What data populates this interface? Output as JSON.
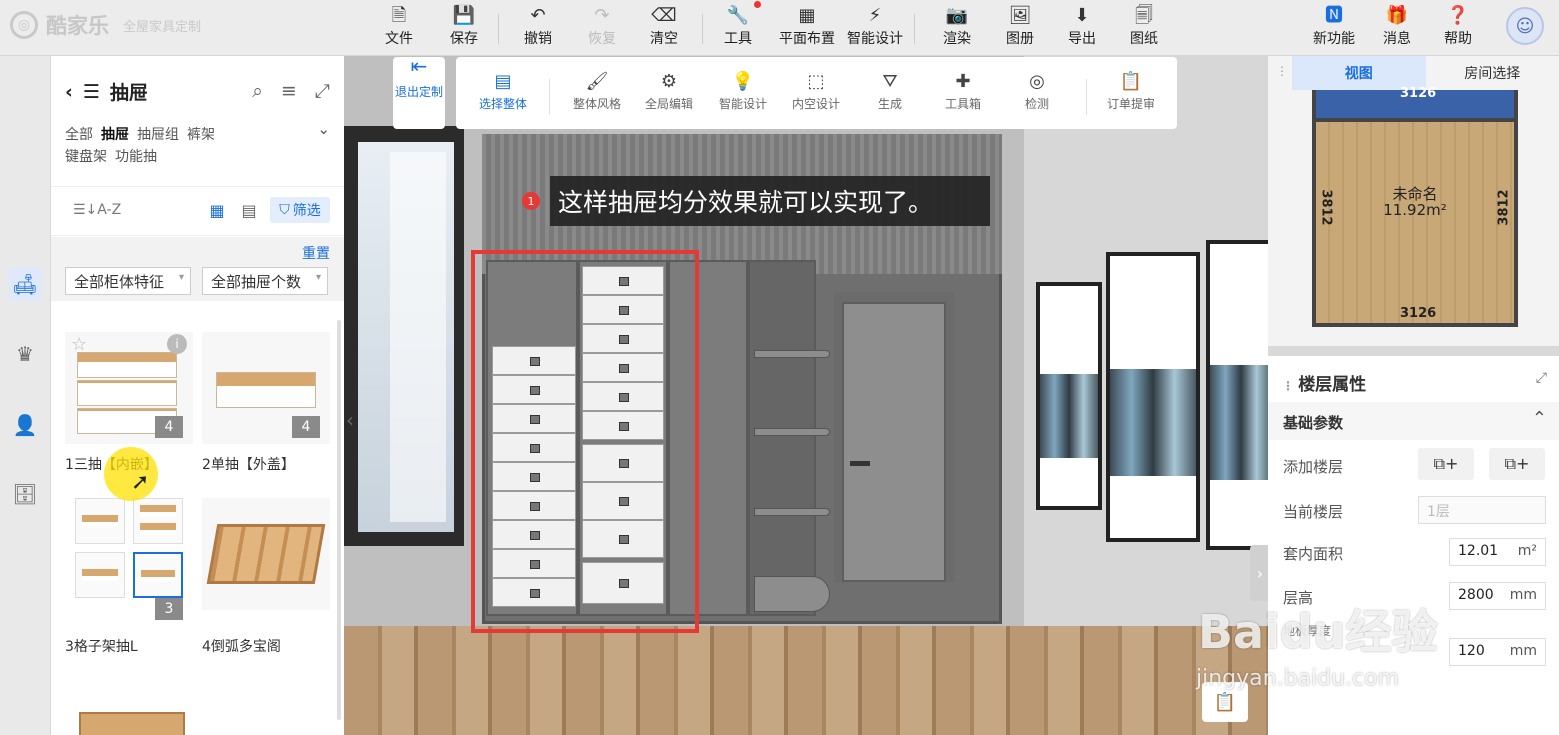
{
  "app": {
    "brand": "酷家乐",
    "sub": "全屋家具定制"
  },
  "toolbar": {
    "items": [
      {
        "label": "文件",
        "icon": "file-icon"
      },
      {
        "label": "保存",
        "icon": "save-icon"
      },
      {
        "label": "撤销",
        "icon": "undo-icon"
      },
      {
        "label": "恢复",
        "icon": "redo-icon"
      },
      {
        "label": "清空",
        "icon": "eraser-icon"
      },
      {
        "label": "工具",
        "icon": "wrench-icon"
      },
      {
        "label": "平面布置",
        "icon": "floorplan-icon"
      },
      {
        "label": "智能设计",
        "icon": "lightning-icon"
      },
      {
        "label": "渲染",
        "icon": "camera-icon"
      },
      {
        "label": "图册",
        "icon": "album-icon"
      },
      {
        "label": "导出",
        "icon": "export-icon"
      },
      {
        "label": "图纸",
        "icon": "drawing-icon"
      }
    ],
    "right": [
      {
        "label": "新功能",
        "icon": "new-feature-icon"
      },
      {
        "label": "消息",
        "icon": "gift-icon"
      },
      {
        "label": "帮助",
        "icon": "help-icon"
      }
    ]
  },
  "left_panel": {
    "title": "抽屉",
    "categories": [
      "全部",
      "抽屉",
      "抽屉组",
      "裤架",
      "键盘架",
      "功能抽"
    ],
    "selected_category": "抽屉",
    "sort": "A-Z",
    "filter": "筛选",
    "reset": "重置",
    "select1": "全部柜体特征",
    "select2": "全部抽屉个数",
    "products": [
      {
        "name": "1三抽【内嵌】",
        "count": "4"
      },
      {
        "name": "2单抽【外盖】",
        "count": "4"
      },
      {
        "name": "3格子架抽L",
        "count": "3"
      },
      {
        "name": "4倒弧多宝阁"
      }
    ]
  },
  "subtoolbar": {
    "exit": "退出定制",
    "items": [
      {
        "label": "选择整体",
        "icon": "select-all-icon"
      },
      {
        "label": "整体风格",
        "icon": "brush-icon"
      },
      {
        "label": "全局编辑",
        "icon": "global-edit-icon"
      },
      {
        "label": "智能设计",
        "icon": "ai-design-icon"
      },
      {
        "label": "内空设计",
        "icon": "inner-space-icon"
      },
      {
        "label": "生成",
        "icon": "generate-icon"
      },
      {
        "label": "工具箱",
        "icon": "puzzle-icon"
      },
      {
        "label": "检测",
        "icon": "detect-icon"
      },
      {
        "label": "订单提审",
        "icon": "order-icon"
      }
    ]
  },
  "viewport": {
    "tooltip_num": "1",
    "tooltip": "这样抽屉均分效果就可以实现了。"
  },
  "right_panel": {
    "tabs": [
      "视图",
      "房间选择"
    ],
    "plan": {
      "room_name": "未命名",
      "area": "11.92m²",
      "top": "3126",
      "bottom": "3126",
      "left": "3812",
      "right": "3812"
    },
    "props_title": "楼层属性",
    "section": "基础参数",
    "add_floor": "添加楼层",
    "current_floor_label": "当前楼层",
    "current_floor": "1层",
    "area_label": "套内面积",
    "area_value": "12.01",
    "area_unit": "m²",
    "height_label": "层高",
    "height_value": "2800",
    "height_unit": "mm",
    "floor_thk_label": "地板厚度",
    "floor_thk_value": "120",
    "floor_thk_unit": "mm"
  },
  "watermark": {
    "text": "Baidu经验",
    "url": "jingyan.baidu.com"
  }
}
